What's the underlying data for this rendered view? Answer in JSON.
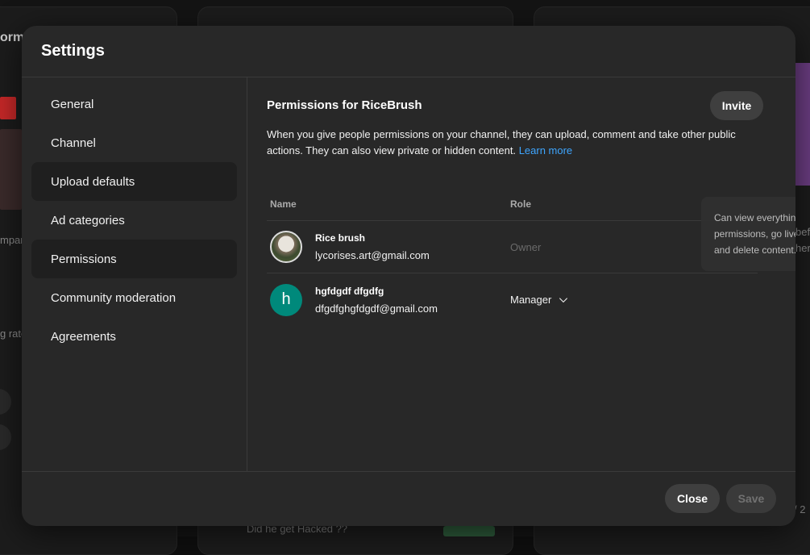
{
  "background": {
    "left_fragment": "ormat",
    "left_snippet1": "mpar",
    "left_snippet2": "g rate",
    "right_snippet1": "bef",
    "right_snippet2": "her",
    "bottom_video": "Did he get Hacked ??",
    "bottom_right": "/ 2"
  },
  "modal": {
    "title": "Settings",
    "nav": [
      {
        "label": "General",
        "active": false
      },
      {
        "label": "Channel",
        "active": false
      },
      {
        "label": "Upload defaults",
        "active": true
      },
      {
        "label": "Ad categories",
        "active": false
      },
      {
        "label": "Permissions",
        "active": true
      },
      {
        "label": "Community moderation",
        "active": false
      },
      {
        "label": "Agreements",
        "active": false
      }
    ],
    "content": {
      "title": "Permissions for RiceBrush",
      "invite_label": "Invite",
      "description": "When you give people permissions on your channel, they can upload, comment and take other public actions. They can also view private or hidden content.",
      "learn_more": "Learn more",
      "table": {
        "col_name": "Name",
        "col_role": "Role",
        "rows": [
          {
            "name": "Rice brush",
            "email": "lycorises.art@gmail.com",
            "role": "Owner",
            "avatar": "photo"
          },
          {
            "name": "hgfdgdf dfgdfg",
            "email": "dfgdfghgfdgdf@gmail.com",
            "role": "Manager",
            "avatar_letter": "h"
          }
        ]
      },
      "tooltip": "Can view everything, manage permissions, go live, and create, edit and delete content."
    },
    "footer": {
      "close_label": "Close",
      "save_label": "Save"
    }
  },
  "colors": {
    "accent_link": "#3ea6ff",
    "avatar_teal": "#00897b"
  }
}
